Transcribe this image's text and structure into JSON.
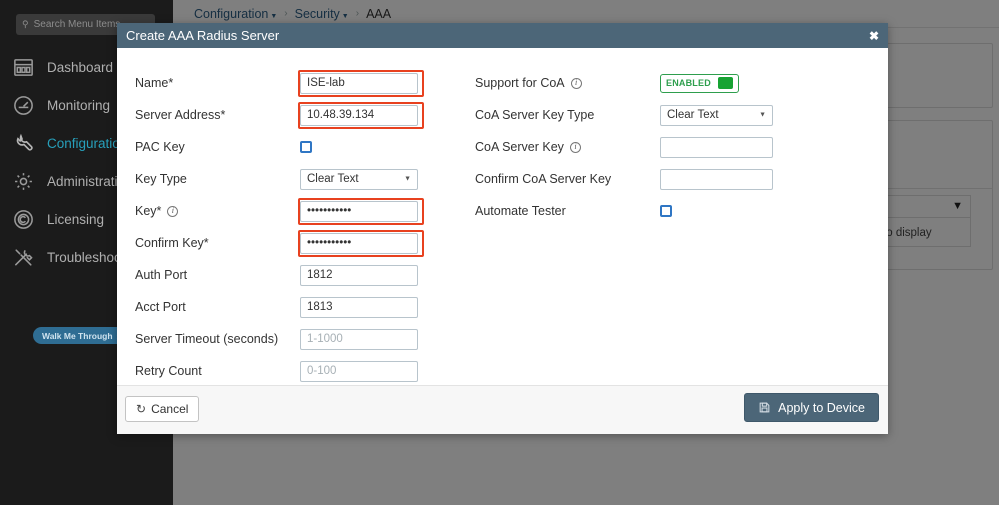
{
  "sidebar": {
    "search": {
      "placeholder": "Search Menu Items",
      "icon": "search-icon"
    },
    "items": [
      {
        "label": "Dashboard",
        "icon": "dashboard-icon"
      },
      {
        "label": "Monitoring",
        "icon": "gauge-icon"
      },
      {
        "label": "Configuration",
        "icon": "wrench-icon"
      },
      {
        "label": "Administration",
        "icon": "gear-icon"
      },
      {
        "label": "Licensing",
        "icon": "copyright-circle-icon"
      },
      {
        "label": "Troubleshooting",
        "icon": "tools-icon"
      }
    ],
    "walk_me_through": "Walk Me Through",
    "walk_me_through_caret": "›"
  },
  "breadcrumb": {
    "items": [
      {
        "label": "Configuration",
        "has_caret": true
      },
      {
        "label": "Security",
        "has_caret": true
      },
      {
        "label": "AAA",
        "has_caret": false
      }
    ],
    "separator": "›"
  },
  "background": {
    "table_empty_text": "items to display",
    "filter_icon": "filter-icon"
  },
  "modal": {
    "title": "Create AAA Radius Server",
    "close_label": "✖",
    "left_fields": [
      {
        "label": "Name*",
        "type": "input",
        "value": "ISE-lab",
        "placeholder": "",
        "highlighted": true,
        "info": false
      },
      {
        "label": "Server Address*",
        "type": "input",
        "value": "10.48.39.134",
        "placeholder": "",
        "highlighted": true,
        "info": false
      },
      {
        "label": "PAC Key",
        "type": "checkbox",
        "checked": false,
        "highlighted": false,
        "info": false
      },
      {
        "label": "Key Type",
        "type": "select",
        "value": "Clear Text",
        "highlighted": false,
        "info": false
      },
      {
        "label": "Key*",
        "type": "password",
        "value": "•••••••••••",
        "placeholder": "",
        "highlighted": true,
        "info": true
      },
      {
        "label": "Confirm Key*",
        "type": "password",
        "value": "•••••••••••",
        "placeholder": "",
        "highlighted": true,
        "info": false
      },
      {
        "label": "Auth Port",
        "type": "input",
        "value": "1812",
        "placeholder": "",
        "highlighted": false,
        "info": false
      },
      {
        "label": "Acct Port",
        "type": "input",
        "value": "1813",
        "placeholder": "",
        "highlighted": false,
        "info": false
      },
      {
        "label": "Server Timeout (seconds)",
        "type": "input",
        "value": "",
        "placeholder": "1-1000",
        "highlighted": false,
        "info": false
      },
      {
        "label": "Retry Count",
        "type": "input",
        "value": "",
        "placeholder": "0-100",
        "highlighted": false,
        "info": false
      }
    ],
    "right_fields": [
      {
        "label": "Support for CoA",
        "type": "toggle",
        "toggle_label": "ENABLED",
        "enabled": true,
        "info": true
      },
      {
        "label": "CoA Server Key Type",
        "type": "select",
        "value": "Clear Text",
        "info": false
      },
      {
        "label": "CoA Server Key",
        "type": "password",
        "value": "",
        "placeholder": "",
        "info": true
      },
      {
        "label": "Confirm CoA Server Key",
        "type": "password",
        "value": "",
        "placeholder": "",
        "info": false
      },
      {
        "label": "Automate Tester",
        "type": "checkbox",
        "checked": false,
        "info": false
      }
    ],
    "footer": {
      "cancel_label": "Cancel",
      "cancel_icon": "undo-icon",
      "apply_label": "Apply to Device",
      "apply_icon": "save-icon"
    }
  },
  "colors": {
    "modal_header": "#4c6678",
    "accent_active": "#27a0bb",
    "highlight": "#e8411f",
    "enabled_green": "#17a333",
    "apply_button": "#4c6678"
  }
}
